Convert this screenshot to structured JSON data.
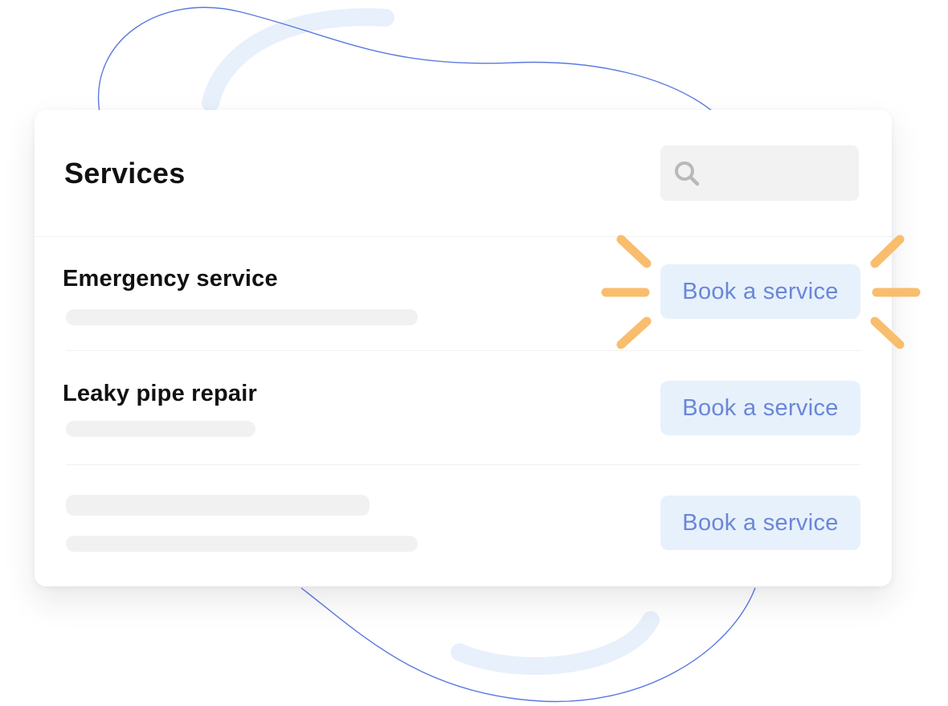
{
  "header": {
    "title": "Services"
  },
  "search": {
    "placeholder": ""
  },
  "services": [
    {
      "name": "Emergency service",
      "button_label": "Book a service"
    },
    {
      "name": "Leaky pipe repair",
      "button_label": "Book a service"
    },
    {
      "name": "",
      "button_label": "Book a service"
    }
  ],
  "icons": {
    "search": "search-icon",
    "highlight": "sparkle-burst-icon"
  },
  "colors": {
    "accent_text": "#6b86d8",
    "button_bg": "#e6f1fc",
    "highlight": "#f9bd6e",
    "deco_line": "#5b79e0",
    "deco_arc": "#e7f0fb"
  }
}
